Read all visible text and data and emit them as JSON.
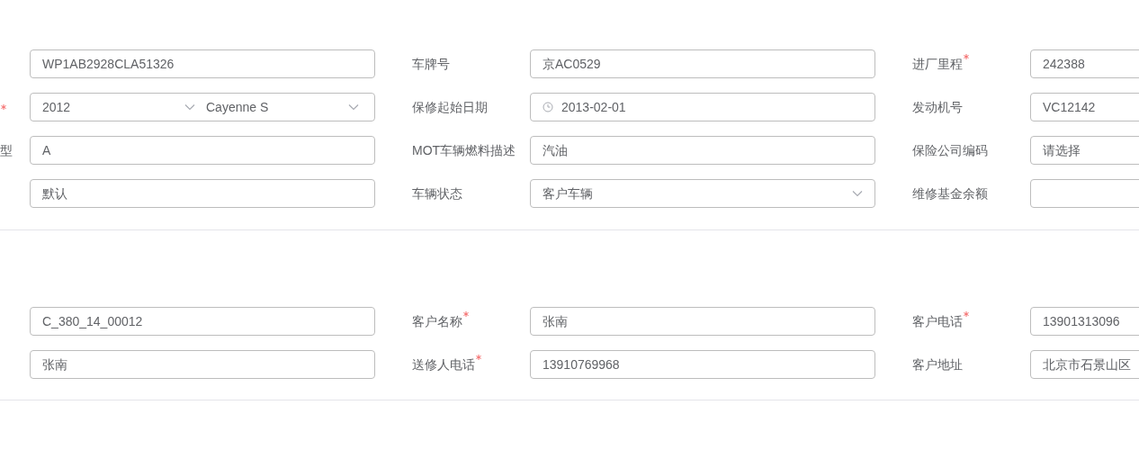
{
  "sections": [
    {
      "rows": [
        [
          {
            "kind": "text",
            "value": "WP1AB2928CLA51326"
          },
          {
            "label": "车牌号",
            "kind": "text",
            "value": "京AC0529"
          },
          {
            "label": "进厂里程",
            "required": true,
            "kind": "text",
            "value": "242388"
          }
        ],
        [
          {
            "required": true,
            "kind": "double-select",
            "values": [
              "2012",
              "Cayenne S"
            ]
          },
          {
            "label": "保修起始日期",
            "kind": "date",
            "value": "2013-02-01"
          },
          {
            "label": "发动机号",
            "kind": "text",
            "value": "VC12142"
          }
        ],
        [
          {
            "label": "型",
            "kind": "text",
            "value": "A"
          },
          {
            "label": "MOT车辆燃料描述",
            "kind": "text",
            "value": "汽油"
          },
          {
            "label": "保险公司编码",
            "kind": "text",
            "value": "请选择"
          }
        ],
        [
          {
            "kind": "text",
            "value": "默认"
          },
          {
            "label": "车辆状态",
            "kind": "select",
            "value": "客户车辆"
          },
          {
            "label": "维修基金余额",
            "kind": "text"
          }
        ]
      ]
    },
    {
      "rows": [
        [
          {
            "kind": "text",
            "value": "C_380_14_00012"
          },
          {
            "label": "客户名称",
            "required": true,
            "kind": "text",
            "value": "张南"
          },
          {
            "label": "客户电话",
            "required": true,
            "kind": "text",
            "value": "13901313096"
          }
        ],
        [
          {
            "kind": "text",
            "value": "张南"
          },
          {
            "label": "送修人电话",
            "required": true,
            "kind": "text",
            "value": "13910769968"
          },
          {
            "label": "客户地址",
            "kind": "text",
            "value": "北京市石景山区"
          }
        ]
      ]
    }
  ]
}
